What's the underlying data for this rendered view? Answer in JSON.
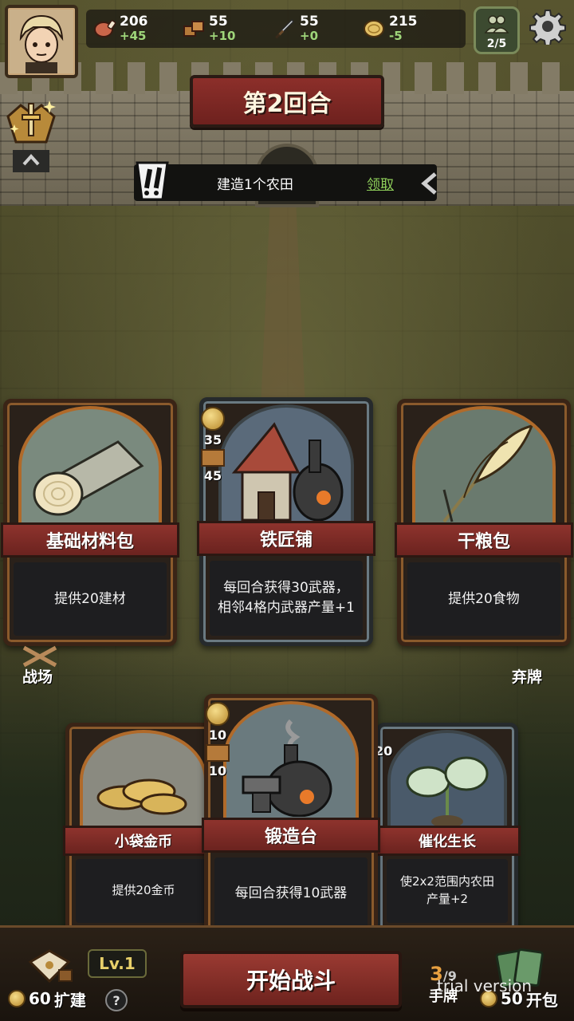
{
  "header": {
    "resources": [
      {
        "icon": "meat-icon",
        "value": "206",
        "delta": "+45"
      },
      {
        "icon": "wood-block-icon",
        "value": "55",
        "delta": "+10"
      },
      {
        "icon": "sword-icon",
        "value": "55",
        "delta": "+0"
      },
      {
        "icon": "gold-coin-icon",
        "value": "215",
        "delta": "-5"
      }
    ],
    "population": "2/5"
  },
  "round": {
    "title": "第2回合"
  },
  "quest": {
    "text": "建造1个农田",
    "claim_label": "领取"
  },
  "cards_top": [
    {
      "title": "基础材料包",
      "description": "提供20建材"
    },
    {
      "title": "铁匠铺",
      "description": "每回合获得30武器，相邻4格内武器产量+1",
      "cost_gold": "35",
      "cost_material": "45"
    },
    {
      "title": "干粮包",
      "description": "提供20食物"
    }
  ],
  "side_labels": {
    "left": "战场",
    "right": "弃牌"
  },
  "cards_bottom": [
    {
      "title": "小袋金币",
      "description": "提供20金币"
    },
    {
      "title": "锻造台",
      "description": "每回合获得10武器",
      "cost_gold": "10",
      "cost_material": "10"
    },
    {
      "title": "催化生长",
      "description": "使2x2范围内农田产量+2",
      "cost_partial": "20"
    }
  ],
  "footer": {
    "level": "Lv.1",
    "expand_cost": "60",
    "expand_label": "扩建",
    "help": "?",
    "start_label": "开始战斗",
    "hand_current": "3",
    "hand_max": "/9",
    "hand_label": "手牌",
    "pack_cost": "50",
    "pack_label": "开包",
    "watermark": "trial version"
  },
  "colors": {
    "positive": "#9fd67a",
    "ribbon": "#8e332d",
    "claim": "#8fcf5a"
  }
}
